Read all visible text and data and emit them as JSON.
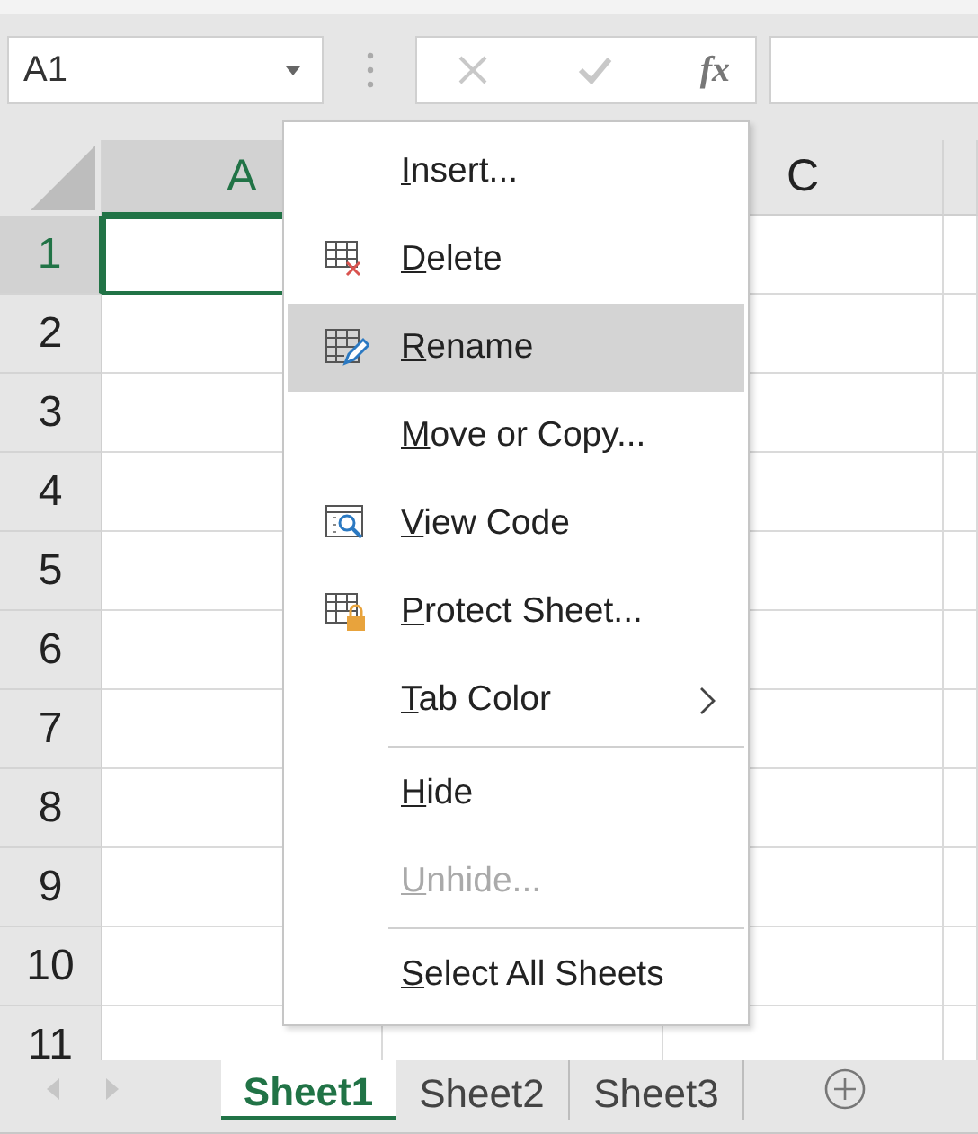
{
  "name_box": {
    "value": "A1"
  },
  "formula_bar": {
    "function_label": "fx",
    "cancel_disabled": true,
    "enter_disabled": true
  },
  "columns": [
    {
      "label": "A",
      "selected": true
    },
    {
      "label": "C",
      "selected": false
    }
  ],
  "rows": [
    {
      "label": "1",
      "selected": true
    },
    {
      "label": "2",
      "selected": false
    },
    {
      "label": "3",
      "selected": false
    },
    {
      "label": "4",
      "selected": false
    },
    {
      "label": "5",
      "selected": false
    },
    {
      "label": "6",
      "selected": false
    },
    {
      "label": "7",
      "selected": false
    },
    {
      "label": "8",
      "selected": false
    },
    {
      "label": "9",
      "selected": false
    },
    {
      "label": "10",
      "selected": false
    },
    {
      "label": "11",
      "selected": false
    }
  ],
  "context_menu": {
    "items": [
      {
        "kind": "item",
        "label": "Insert...",
        "disabled": false,
        "selected": false
      },
      {
        "kind": "item",
        "label": "Delete",
        "disabled": false,
        "selected": false
      },
      {
        "kind": "item",
        "label": "Rename",
        "disabled": false,
        "selected": true
      },
      {
        "kind": "item",
        "label": "Move or Copy...",
        "disabled": false,
        "selected": false
      },
      {
        "kind": "item",
        "label": "View Code",
        "disabled": false,
        "selected": false
      },
      {
        "kind": "item",
        "label": "Protect Sheet...",
        "disabled": false,
        "selected": false
      },
      {
        "kind": "submenu",
        "label": "Tab Color",
        "disabled": false,
        "selected": false
      },
      {
        "kind": "separator"
      },
      {
        "kind": "item",
        "label": "Hide",
        "disabled": false,
        "selected": false
      },
      {
        "kind": "item",
        "label": "Unhide...",
        "disabled": true,
        "selected": false
      },
      {
        "kind": "separator"
      },
      {
        "kind": "item",
        "label": "Select All Sheets",
        "disabled": false,
        "selected": false
      }
    ]
  },
  "sheet_tabs": [
    {
      "label": "Sheet1",
      "selected": true
    },
    {
      "label": "Sheet2",
      "selected": false
    },
    {
      "label": "Sheet3",
      "selected": false
    }
  ]
}
